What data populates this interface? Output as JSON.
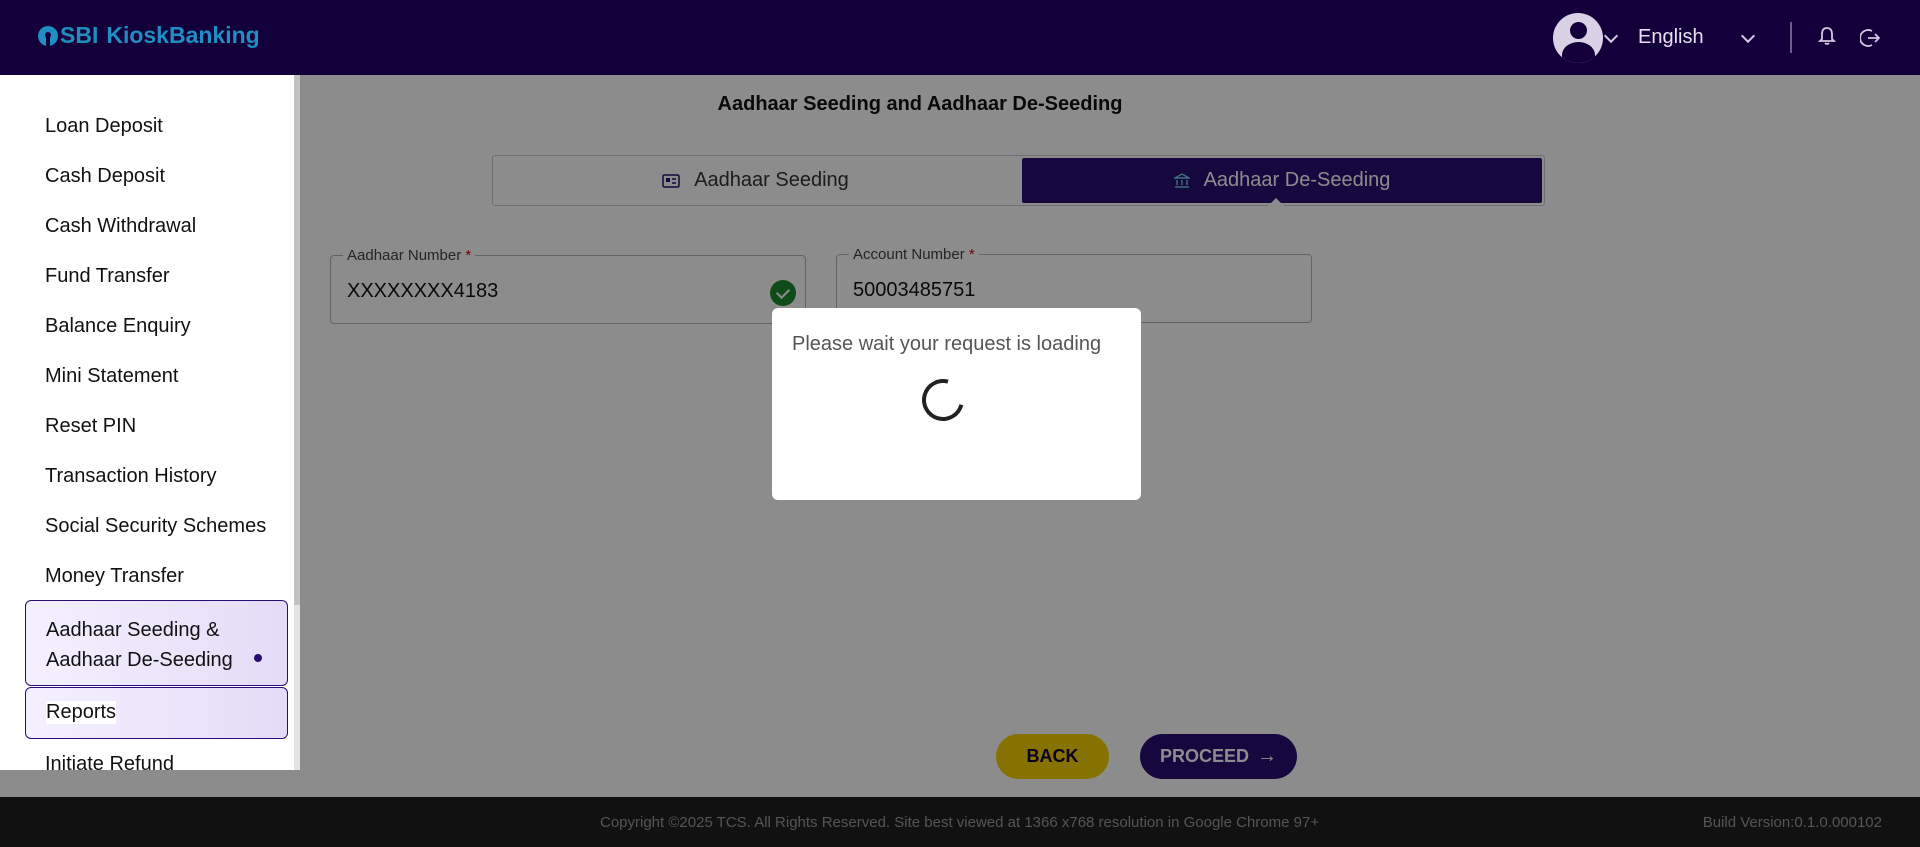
{
  "header": {
    "logo_sbi": "SBI",
    "logo_product": "KioskBanking",
    "language": "English"
  },
  "page": {
    "title": "Aadhaar Seeding and Aadhaar De-Seeding"
  },
  "tabs": [
    {
      "label": "Aadhaar Seeding",
      "icon": "id-card-icon",
      "active": false
    },
    {
      "label": "Aadhaar De-Seeding",
      "icon": "bank-icon",
      "active": true
    }
  ],
  "form": {
    "aadhaar_label": "Aadhaar Number",
    "aadhaar_value": "XXXXXXXX4183",
    "account_label": "Account Number",
    "account_value": "50003485751",
    "required_mark": "*"
  },
  "buttons": {
    "back": "BACK",
    "proceed": "PROCEED"
  },
  "footer": {
    "copyright": "Copyright ©2025 TCS. All Rights Reserved. Site best viewed at 1366 x768 resolution in Google Chrome 97+",
    "build": "Build Version:0.1.0.000102"
  },
  "sidebar": {
    "items": [
      {
        "label": "Loan Deposit"
      },
      {
        "label": "Cash Deposit"
      },
      {
        "label": "Cash Withdrawal"
      },
      {
        "label": "Fund Transfer"
      },
      {
        "label": "Balance Enquiry"
      },
      {
        "label": "Mini Statement"
      },
      {
        "label": "Reset PIN"
      },
      {
        "label": "Transaction History"
      },
      {
        "label": "Social Security Schemes"
      },
      {
        "label": "Money Transfer"
      },
      {
        "label_line1": "Aadhaar Seeding &",
        "label_line2": "Aadhaar De-Seeding",
        "active": true
      },
      {
        "label": "Reports"
      },
      {
        "label": "Initiate Refund"
      }
    ]
  },
  "dialog": {
    "message": "Please wait your request is loading"
  },
  "colors": {
    "brand_dark": "#13003a",
    "accent_purple": "#2a0d74",
    "back_yellow": "#f5d000",
    "logo_blue": "#1f8ec2"
  }
}
